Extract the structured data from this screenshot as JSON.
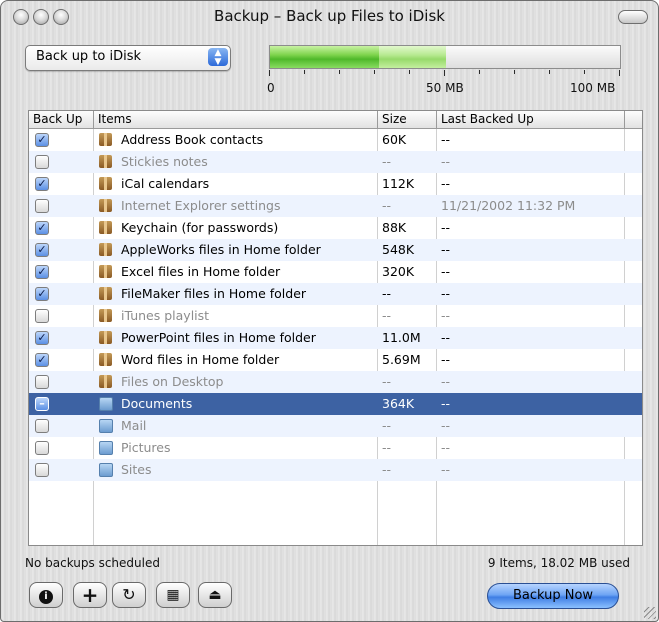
{
  "window": {
    "title": "Backup – Back up Files to iDisk"
  },
  "toolbar": {
    "destination_popup": "Back up to iDisk",
    "meter": {
      "used_fraction": 0.31,
      "new_fraction": 0.19,
      "labels": [
        "0",
        "50 MB",
        "100 MB"
      ]
    }
  },
  "table": {
    "headers": {
      "backup": "Back Up",
      "items": "Items",
      "size": "Size",
      "last": "Last Backed Up"
    },
    "rows": [
      {
        "checked": "on",
        "icon": "package-icon",
        "name": "Address Book contacts",
        "size": "60K",
        "last": "--",
        "dim": false,
        "selected": false
      },
      {
        "checked": "off",
        "icon": "package-icon",
        "name": "Stickies notes",
        "size": "--",
        "last": "--",
        "dim": true,
        "selected": false
      },
      {
        "checked": "on",
        "icon": "package-icon",
        "name": "iCal calendars",
        "size": "112K",
        "last": "--",
        "dim": false,
        "selected": false
      },
      {
        "checked": "off",
        "icon": "package-icon",
        "name": "Internet Explorer settings",
        "size": "--",
        "last": "11/21/2002 11:32 PM",
        "dim": true,
        "selected": false
      },
      {
        "checked": "on",
        "icon": "package-icon",
        "name": "Keychain (for passwords)",
        "size": "88K",
        "last": "--",
        "dim": false,
        "selected": false
      },
      {
        "checked": "on",
        "icon": "package-icon",
        "name": "AppleWorks files in Home folder",
        "size": "548K",
        "last": "--",
        "dim": false,
        "selected": false
      },
      {
        "checked": "on",
        "icon": "package-icon",
        "name": "Excel files in Home folder",
        "size": "320K",
        "last": "--",
        "dim": false,
        "selected": false
      },
      {
        "checked": "on",
        "icon": "package-icon",
        "name": "FileMaker files in Home folder",
        "size": "--",
        "last": "--",
        "dim": false,
        "selected": false
      },
      {
        "checked": "off",
        "icon": "package-icon",
        "name": "iTunes playlist",
        "size": "--",
        "last": "--",
        "dim": true,
        "selected": false
      },
      {
        "checked": "on",
        "icon": "package-icon",
        "name": "PowerPoint files in Home folder",
        "size": "11.0M",
        "last": "--",
        "dim": false,
        "selected": false
      },
      {
        "checked": "on",
        "icon": "package-icon",
        "name": "Word files in Home folder",
        "size": "5.69M",
        "last": "--",
        "dim": false,
        "selected": false
      },
      {
        "checked": "off",
        "icon": "package-icon",
        "name": "Files on Desktop",
        "size": "--",
        "last": "--",
        "dim": true,
        "selected": false
      },
      {
        "checked": "mixed",
        "icon": "folder-icon",
        "name": "Documents",
        "size": "364K",
        "last": "--",
        "dim": false,
        "selected": true
      },
      {
        "checked": "off",
        "icon": "folder-icon",
        "name": "Mail",
        "size": "--",
        "last": "--",
        "dim": true,
        "selected": false
      },
      {
        "checked": "off",
        "icon": "folder-icon",
        "name": "Pictures",
        "size": "--",
        "last": "--",
        "dim": true,
        "selected": false
      },
      {
        "checked": "off",
        "icon": "folder-icon",
        "name": "Sites",
        "size": "--",
        "last": "--",
        "dim": true,
        "selected": false
      }
    ]
  },
  "status": {
    "left": "No backups scheduled",
    "right": "9 Items, 18.02 MB used"
  },
  "buttons": {
    "info_icon": "info-icon",
    "add_icon": "plus-icon",
    "refresh_icon": "refresh-icon",
    "calendar_icon": "calendar-icon",
    "eject_icon": "eject-icon",
    "backup_now": "Backup Now"
  },
  "colors": {
    "selection": "#3d62a3",
    "meter_used": "#4fb82a",
    "accent": "#3f7ee4"
  }
}
